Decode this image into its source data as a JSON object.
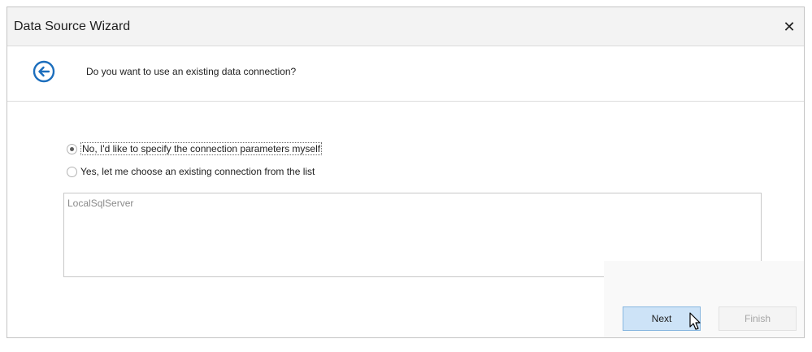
{
  "window": {
    "title": "Data Source Wizard",
    "close_symbol": "✕"
  },
  "header": {
    "question": "Do you want to use an existing data connection?",
    "back_icon": "arrow-left-circle-icon"
  },
  "options": [
    {
      "label": "No, I'd like to specify the connection parameters myself",
      "selected": true
    },
    {
      "label": "Yes, let me choose an existing connection from the list",
      "selected": false
    }
  ],
  "connections": {
    "items": [
      "LocalSqlServer"
    ]
  },
  "buttons": {
    "next_label": "Next",
    "finish_label": "Finish"
  },
  "colors": {
    "accent": "#1c6ebd",
    "next_bg": "#cde3f7"
  }
}
